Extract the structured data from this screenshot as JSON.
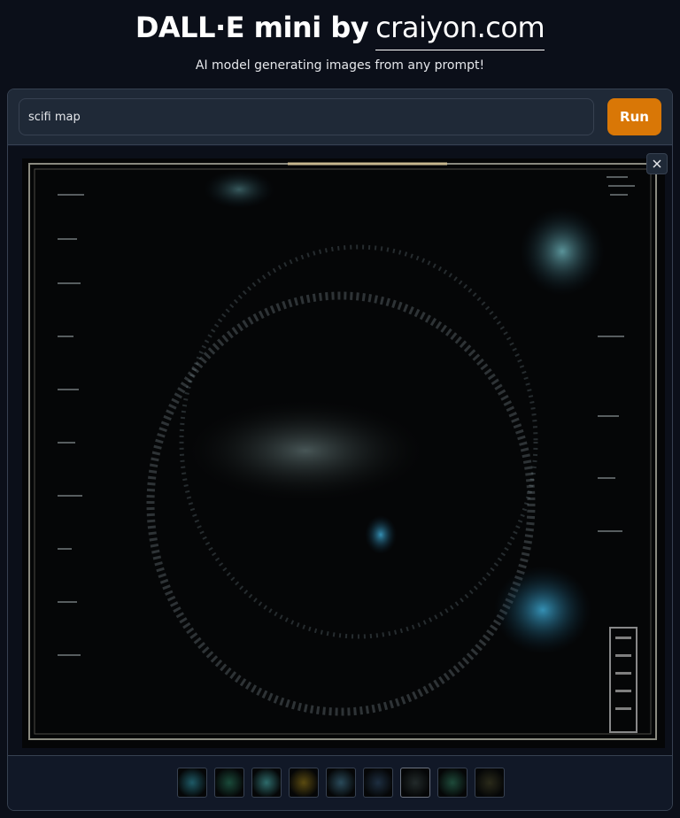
{
  "header": {
    "title": "DALL·E mini by",
    "link": "craiyon.com",
    "subtitle": "AI model generating images from any prompt!"
  },
  "prompt": {
    "value": "scifi map"
  },
  "run_label": "Run",
  "gallery": {
    "selected_index": 6,
    "thumbnail_count": 9,
    "thumb_colors": [
      "#1e5a66",
      "#1a4a3a",
      "#2e6b6b",
      "#5a4a10",
      "#2a4a5a",
      "#1d2e40",
      "#222a2a",
      "#1e4a3a",
      "#2a2a1a"
    ]
  },
  "colors": {
    "accent": "#d97706",
    "background": "#0b0f19",
    "panel": "#111827"
  }
}
